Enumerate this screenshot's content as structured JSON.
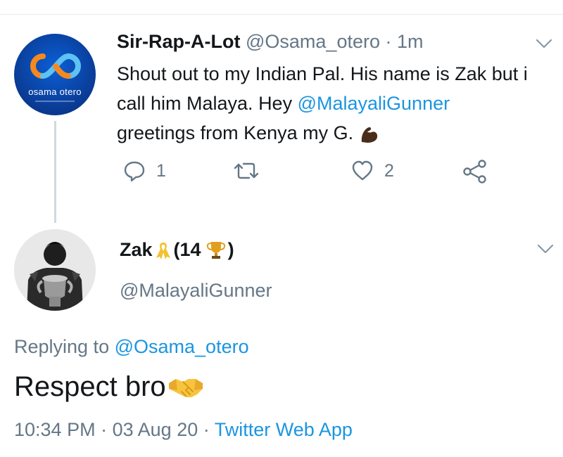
{
  "parent_tweet": {
    "display_name": "Sir-Rap-A-Lot",
    "handle": "@Osama_otero",
    "separator": "·",
    "time": "1m",
    "avatar_text": "osama otero",
    "text_before_mention": "Shout out to my Indian Pal. His name is Zak but i call him Malaya. Hey ",
    "mention": "@MalayaliGunner",
    "text_after_mention": " greetings from Kenya my G. ",
    "emoji": "flexed-biceps",
    "reply_count": "1",
    "like_count": "2",
    "icons": [
      "reply-icon",
      "retweet-icon",
      "like-icon",
      "share-icon",
      "chevron-down-icon"
    ]
  },
  "reply_tweet": {
    "display_name_start": "Zak",
    "display_name_middle": "(14",
    "display_name_end": ")",
    "name_emojis": [
      "yellow-ribbon",
      "trophy"
    ],
    "handle": "@MalayaliGunner",
    "replying_label": "Replying to",
    "replying_to": "@Osama_otero",
    "text": "Respect bro",
    "text_emoji": "handshake",
    "time": "10:34 PM",
    "sep1": "·",
    "date": "03 Aug 20",
    "sep2": "·",
    "source": "Twitter Web App"
  },
  "colors": {
    "link": "#1b95e0",
    "secondary": "#657786",
    "primary": "#14171a",
    "brand_avatar": "#0a3f9c",
    "logo_orange": "#f5891f"
  }
}
